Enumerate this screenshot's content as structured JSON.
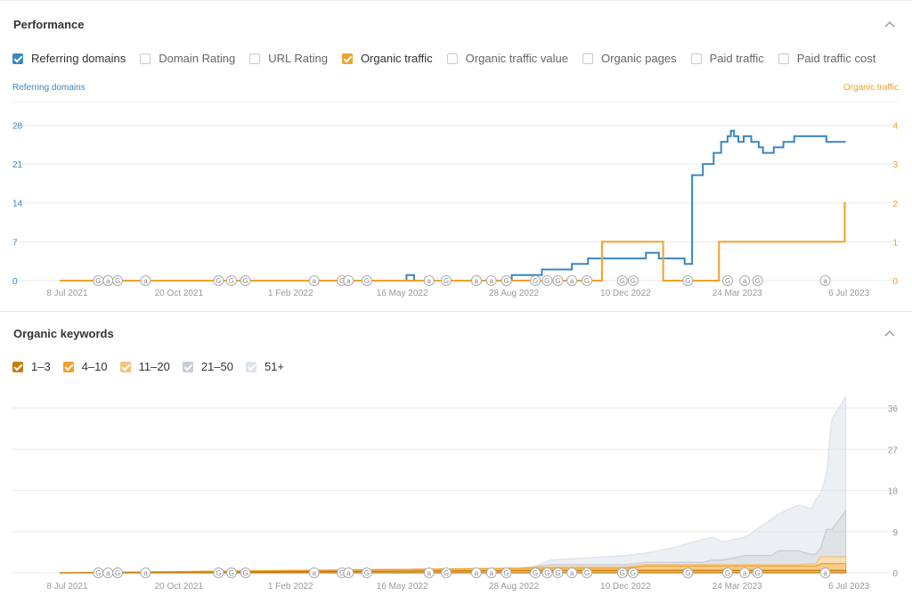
{
  "performance": {
    "title": "Performance",
    "metrics": [
      {
        "label": "Referring domains",
        "checked": true,
        "color": "#3a86c0"
      },
      {
        "label": "Domain Rating",
        "checked": false
      },
      {
        "label": "URL Rating",
        "checked": false
      },
      {
        "label": "Organic traffic",
        "checked": true,
        "color": "#f0a129"
      },
      {
        "label": "Organic traffic value",
        "checked": false
      },
      {
        "label": "Organic pages",
        "checked": false
      },
      {
        "label": "Paid traffic",
        "checked": false
      },
      {
        "label": "Paid traffic cost",
        "checked": false
      }
    ],
    "left_axis_title": "Referring domains",
    "right_axis_title": "Organic traffic"
  },
  "keywords": {
    "title": "Organic keywords",
    "legend": [
      {
        "label": "1–3",
        "color": "#c77d0a"
      },
      {
        "label": "4–10",
        "color": "#f0a129"
      },
      {
        "label": "11–20",
        "color": "#f6c278"
      },
      {
        "label": "21–50",
        "color": "#c5ccd6"
      },
      {
        "label": "51+",
        "color": "#dde2ea"
      }
    ]
  },
  "chart_data": [
    {
      "type": "line",
      "title": "",
      "x_ticks": [
        "8 Jul 2021",
        "20 Oct 2021",
        "1 Feb 2022",
        "16 May 2022",
        "28 Aug 2022",
        "10 Dec 2022",
        "24 Mar 2023",
        "6 Jul 2023"
      ],
      "xlim": [
        "2021-07-01",
        "2023-07-10"
      ],
      "grid": true,
      "y_left": {
        "label": "Referring domains",
        "ticks": [
          0,
          7,
          14,
          21,
          28
        ],
        "ylim": [
          0,
          30
        ]
      },
      "y_right": {
        "label": "Organic traffic",
        "ticks": [
          0,
          1,
          2,
          3,
          4
        ],
        "ylim": [
          0,
          4.29
        ]
      },
      "series": [
        {
          "name": "Referring domains",
          "axis": "left",
          "color": "#3a86c0",
          "step": true,
          "points": [
            [
              "2021-07-01",
              0
            ],
            [
              "2022-05-20",
              0
            ],
            [
              "2022-05-20",
              1
            ],
            [
              "2022-05-27",
              1
            ],
            [
              "2022-05-27",
              0
            ],
            [
              "2022-08-26",
              0
            ],
            [
              "2022-08-26",
              1
            ],
            [
              "2022-09-23",
              1
            ],
            [
              "2022-09-23",
              2
            ],
            [
              "2022-10-21",
              2
            ],
            [
              "2022-10-21",
              3
            ],
            [
              "2022-11-05",
              3
            ],
            [
              "2022-11-05",
              4
            ],
            [
              "2022-12-29",
              4
            ],
            [
              "2022-12-29",
              5
            ],
            [
              "2023-01-10",
              5
            ],
            [
              "2023-01-10",
              4
            ],
            [
              "2023-02-03",
              4
            ],
            [
              "2023-02-03",
              3
            ],
            [
              "2023-02-10",
              3
            ],
            [
              "2023-02-10",
              19
            ],
            [
              "2023-02-20",
              19
            ],
            [
              "2023-02-20",
              21
            ],
            [
              "2023-03-02",
              21
            ],
            [
              "2023-03-02",
              23
            ],
            [
              "2023-03-09",
              23
            ],
            [
              "2023-03-09",
              25
            ],
            [
              "2023-03-15",
              25
            ],
            [
              "2023-03-15",
              26
            ],
            [
              "2023-03-18",
              26
            ],
            [
              "2023-03-18",
              27
            ],
            [
              "2023-03-21",
              27
            ],
            [
              "2023-03-21",
              26
            ],
            [
              "2023-03-25",
              26
            ],
            [
              "2023-03-25",
              25
            ],
            [
              "2023-03-30",
              25
            ],
            [
              "2023-03-30",
              26
            ],
            [
              "2023-04-06",
              26
            ],
            [
              "2023-04-06",
              25
            ],
            [
              "2023-04-13",
              25
            ],
            [
              "2023-04-13",
              24
            ],
            [
              "2023-04-17",
              24
            ],
            [
              "2023-04-17",
              23
            ],
            [
              "2023-04-27",
              23
            ],
            [
              "2023-04-27",
              24
            ],
            [
              "2023-05-06",
              24
            ],
            [
              "2023-05-06",
              25
            ],
            [
              "2023-05-16",
              25
            ],
            [
              "2023-05-16",
              26
            ],
            [
              "2023-06-15",
              26
            ],
            [
              "2023-06-15",
              25
            ],
            [
              "2023-07-03",
              25
            ]
          ]
        },
        {
          "name": "Organic traffic",
          "axis": "right",
          "color": "#f0a129",
          "step": true,
          "points": [
            [
              "2021-07-01",
              0
            ],
            [
              "2022-11-18",
              0
            ],
            [
              "2022-11-18",
              1
            ],
            [
              "2023-01-14",
              1
            ],
            [
              "2023-01-14",
              0
            ],
            [
              "2023-03-07",
              0
            ],
            [
              "2023-03-07",
              1
            ],
            [
              "2023-07-02",
              1
            ],
            [
              "2023-07-02",
              2
            ],
            [
              "2023-07-03",
              2
            ]
          ]
        }
      ],
      "annotations": [
        {
          "date": "2021-08-06",
          "label": "G"
        },
        {
          "date": "2021-08-15",
          "label": "a"
        },
        {
          "date": "2021-08-24",
          "label": "G"
        },
        {
          "date": "2021-09-19",
          "label": "a"
        },
        {
          "date": "2021-11-26",
          "label": "G"
        },
        {
          "date": "2021-12-08",
          "label": "G"
        },
        {
          "date": "2021-12-21",
          "label": "G"
        },
        {
          "date": "2022-02-23",
          "label": "a"
        },
        {
          "date": "2022-03-21",
          "label": "G"
        },
        {
          "date": "2022-03-27",
          "label": "a"
        },
        {
          "date": "2022-04-13",
          "label": "G"
        },
        {
          "date": "2022-06-10",
          "label": "a"
        },
        {
          "date": "2022-06-26",
          "label": "G"
        },
        {
          "date": "2022-07-24",
          "label": "a"
        },
        {
          "date": "2022-08-07",
          "label": "a"
        },
        {
          "date": "2022-08-21",
          "label": "G"
        },
        {
          "date": "2022-09-17",
          "label": "G"
        },
        {
          "date": "2022-09-28",
          "label": "G"
        },
        {
          "date": "2022-10-08",
          "label": "G"
        },
        {
          "date": "2022-10-21",
          "label": "a"
        },
        {
          "date": "2022-11-04",
          "label": "G"
        },
        {
          "date": "2022-12-07",
          "label": "G"
        },
        {
          "date": "2022-12-17",
          "label": "G"
        },
        {
          "date": "2023-02-06",
          "label": "G"
        },
        {
          "date": "2023-03-15",
          "label": "G"
        },
        {
          "date": "2023-03-31",
          "label": "a"
        },
        {
          "date": "2023-04-12",
          "label": "G"
        },
        {
          "date": "2023-06-14",
          "label": "a"
        }
      ]
    },
    {
      "type": "area",
      "title": "",
      "x_ticks": [
        "8 Jul 2021",
        "20 Oct 2021",
        "1 Feb 2022",
        "16 May 2022",
        "28 Aug 2022",
        "10 Dec 2022",
        "24 Mar 2023",
        "6 Jul 2023"
      ],
      "xlim": [
        "2021-07-01",
        "2023-07-10"
      ],
      "grid": true,
      "y_right": {
        "ticks": [
          0,
          9,
          18,
          27,
          36
        ],
        "ylim": [
          0,
          36
        ]
      },
      "stacked": true,
      "series": [
        {
          "name": "1–3",
          "color": "#c77d0a",
          "points": [
            [
              "2021-07-01",
              0
            ],
            [
              "2022-09-01",
              0
            ],
            [
              "2022-09-01",
              0.5
            ],
            [
              "2023-07-03",
              0.5
            ]
          ]
        },
        {
          "name": "4–10",
          "color": "#f0a129",
          "points": [
            [
              "2021-07-01",
              0
            ],
            [
              "2022-09-01",
              0
            ],
            [
              "2022-09-01",
              0.5
            ],
            [
              "2022-12-29",
              0.5
            ],
            [
              "2022-12-29",
              1
            ],
            [
              "2023-06-10",
              1
            ],
            [
              "2023-06-10",
              1.5
            ],
            [
              "2023-07-03",
              1.5
            ]
          ]
        },
        {
          "name": "11–20",
          "color": "#f6c278",
          "points": [
            [
              "2021-07-01",
              0
            ],
            [
              "2022-09-15",
              0
            ],
            [
              "2022-09-15",
              0.3
            ],
            [
              "2023-06-01",
              0.5
            ],
            [
              "2023-06-10",
              1.5
            ],
            [
              "2023-07-03",
              1.5
            ]
          ]
        },
        {
          "name": "21–50",
          "color": "#c5ccd6",
          "points": [
            [
              "2021-07-01",
              0
            ],
            [
              "2022-10-01",
              0
            ],
            [
              "2022-10-01",
              0.5
            ],
            [
              "2023-03-01",
              1
            ],
            [
              "2023-04-01",
              2
            ],
            [
              "2023-05-01",
              3
            ],
            [
              "2023-06-01",
              2
            ],
            [
              "2023-06-15",
              6
            ],
            [
              "2023-07-03",
              10
            ]
          ]
        },
        {
          "name": "51+",
          "color": "#dde2ea",
          "points": [
            [
              "2021-07-01",
              0
            ],
            [
              "2022-10-01",
              0
            ],
            [
              "2022-10-01",
              1
            ],
            [
              "2022-12-10",
              2
            ],
            [
              "2023-01-20",
              3
            ],
            [
              "2023-02-20",
              5
            ],
            [
              "2023-03-10",
              4
            ],
            [
              "2023-04-01",
              4
            ],
            [
              "2023-04-25",
              8
            ],
            [
              "2023-05-20",
              10
            ],
            [
              "2023-06-05",
              12
            ],
            [
              "2023-06-20",
              24
            ],
            [
              "2023-07-03",
              25
            ]
          ]
        }
      ],
      "annotations": [
        {
          "date": "2021-08-06",
          "label": "G"
        },
        {
          "date": "2021-08-15",
          "label": "a"
        },
        {
          "date": "2021-08-24",
          "label": "G"
        },
        {
          "date": "2021-09-19",
          "label": "a"
        },
        {
          "date": "2021-11-26",
          "label": "G"
        },
        {
          "date": "2021-12-08",
          "label": "G"
        },
        {
          "date": "2021-12-21",
          "label": "G"
        },
        {
          "date": "2022-02-23",
          "label": "a"
        },
        {
          "date": "2022-03-21",
          "label": "G"
        },
        {
          "date": "2022-03-27",
          "label": "a"
        },
        {
          "date": "2022-04-13",
          "label": "G"
        },
        {
          "date": "2022-06-10",
          "label": "a"
        },
        {
          "date": "2022-06-26",
          "label": "G"
        },
        {
          "date": "2022-07-24",
          "label": "a"
        },
        {
          "date": "2022-08-07",
          "label": "a"
        },
        {
          "date": "2022-08-21",
          "label": "G"
        },
        {
          "date": "2022-09-17",
          "label": "G"
        },
        {
          "date": "2022-09-28",
          "label": "G"
        },
        {
          "date": "2022-10-08",
          "label": "G"
        },
        {
          "date": "2022-10-21",
          "label": "a"
        },
        {
          "date": "2022-11-04",
          "label": "G"
        },
        {
          "date": "2022-12-07",
          "label": "G"
        },
        {
          "date": "2022-12-17",
          "label": "G"
        },
        {
          "date": "2023-02-06",
          "label": "G"
        },
        {
          "date": "2023-03-15",
          "label": "G"
        },
        {
          "date": "2023-03-31",
          "label": "a"
        },
        {
          "date": "2023-04-12",
          "label": "G"
        },
        {
          "date": "2023-06-14",
          "label": "a"
        }
      ]
    }
  ]
}
